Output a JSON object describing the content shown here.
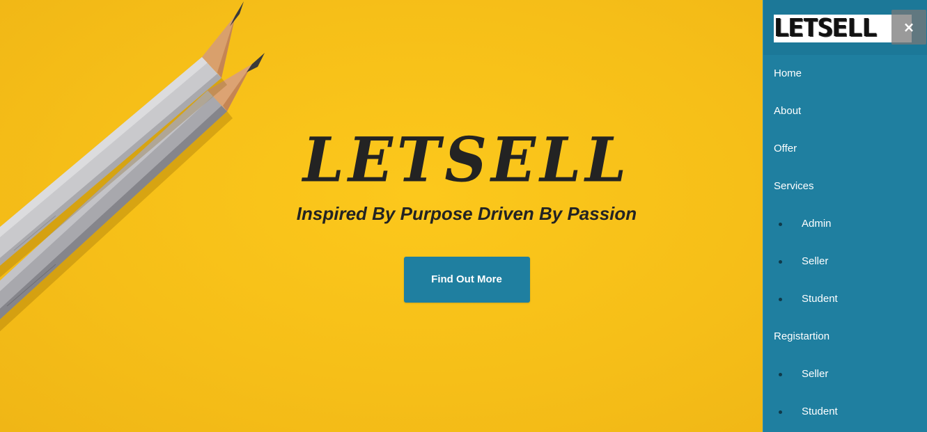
{
  "hero": {
    "brand": "LETSELL",
    "tagline": "Inspired By Purpose Driven By Passion",
    "cta_label": "Find Out More",
    "background_color": "#f8c21a",
    "text_color": "#232323"
  },
  "sidebar": {
    "logo_text": "LETSELL",
    "close_icon": "×",
    "background_color": "#1f7fa0",
    "nav": {
      "home": "Home",
      "about": "About",
      "offer": "Offer",
      "services": "Services",
      "services_admin": "Admin",
      "services_seller": "Seller",
      "services_student": "Student",
      "registration": "Registartion",
      "registration_seller": "Seller",
      "registration_student": "Student"
    }
  },
  "icons": {
    "close": "close-icon",
    "bullet": "bullet-icon"
  }
}
